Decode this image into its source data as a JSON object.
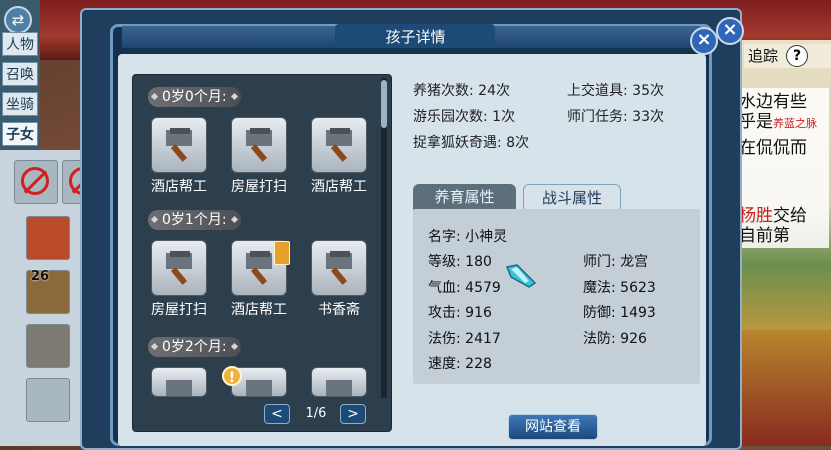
{
  "dialog": {
    "title": "孩子详情"
  },
  "side_tabs": [
    "人物",
    "召唤",
    "坐骑",
    "子女"
  ],
  "left_panel": {
    "item_count": "26"
  },
  "track": {
    "label": "追踪",
    "help": "?"
  },
  "story": [
    {
      "text": "水边有些"
    },
    {
      "text": "乎是",
      "red": "养蓝之脉"
    },
    {
      "text": "在侃侃而"
    },
    {
      "text": "",
      "red": "杨胜",
      "after": "交给"
    },
    {
      "text": "自前第"
    }
  ],
  "schedule": {
    "groups": [
      {
        "age": "0岁0个月:",
        "activities": [
          "酒店帮工",
          "房屋打扫",
          "酒店帮工"
        ]
      },
      {
        "age": "0岁1个月:",
        "activities": [
          "房屋打扫",
          "酒店帮工",
          "书香斋"
        ]
      },
      {
        "age": "0岁2个月:",
        "activities": [
          "",
          "",
          ""
        ]
      }
    ],
    "page": "1/6",
    "prev": "<",
    "next": ">"
  },
  "counts": {
    "pig_raising": "养猪次数: 24次",
    "amusement_park": "游乐园次数: 1次",
    "fox_demon": "捉拿狐妖奇遇: 8次",
    "turn_in_items": "上交道具: 35次",
    "sect_tasks": "师门任务: 33次"
  },
  "tabs": {
    "nurture": "养育属性",
    "battle": "战斗属性"
  },
  "attributes": {
    "name": "名字: 小神灵",
    "level": "等级: 180",
    "sect": "师门: 龙宫",
    "hp": "气血: 4579",
    "mp": "魔法: 5623",
    "attack": "攻击: 916",
    "defense": "防御: 1493",
    "spell_damage": "法伤: 2417",
    "spell_defense": "法防: 926",
    "speed": "速度: 228"
  },
  "web_button": "网站查看",
  "colors": {
    "accent": "#2f66b8",
    "panel": "#14314f"
  }
}
